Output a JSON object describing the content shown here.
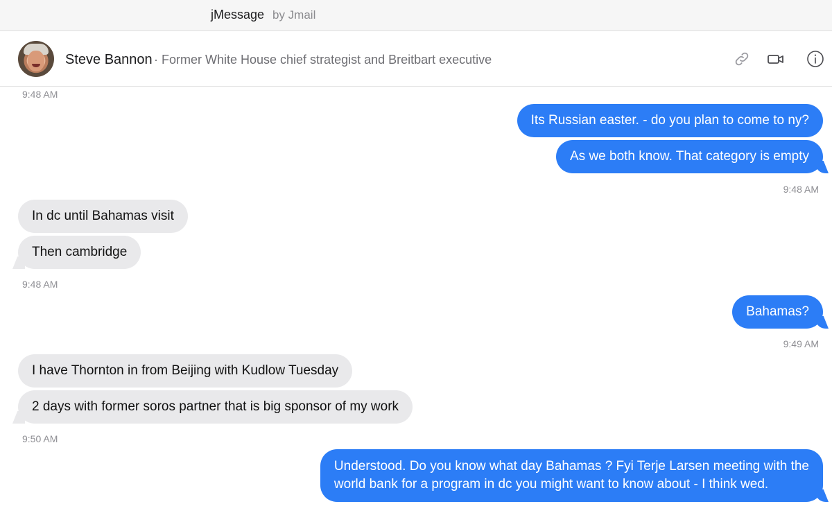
{
  "app": {
    "name": "jMessage",
    "by": "by Jmail"
  },
  "contact": {
    "name": "Steve Bannon",
    "description": "· Former White House chief strategist and Breitbart executive"
  },
  "header_icons": [
    "link-icon",
    "video-icon",
    "info-icon"
  ],
  "colors": {
    "outgoing": "#2c7df6",
    "incoming": "#e9e9eb"
  },
  "thread": {
    "ts1": "9:48 AM",
    "m1": "Its Russian easter. - do you plan to come to ny?",
    "m2": "As we both know. That category is empty",
    "ts2": "9:48 AM",
    "m3": "In dc until Bahamas visit",
    "m4": "Then cambridge",
    "ts3": "9:48 AM",
    "m5": "Bahamas?",
    "ts4": "9:49 AM",
    "m6": "I have Thornton in from Beijing with Kudlow Tuesday",
    "m7": "2 days with former soros partner that is big sponsor of my work",
    "ts5": "9:50 AM",
    "m8_line1": "Understood. Do you know what day Bahamas ? Fyi Terje Larsen meeting with the",
    "m8_line2": "world bank for a program in dc you might want to know about - I think wed."
  }
}
